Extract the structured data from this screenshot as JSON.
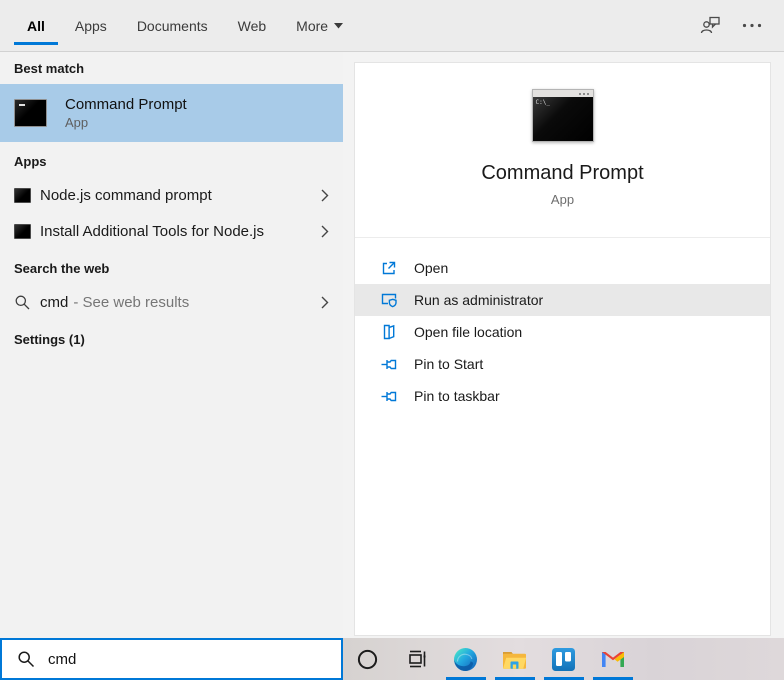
{
  "colors": {
    "accent": "#0078d7",
    "best_match_highlight": "#a8cbe8",
    "selected_action_bg": "#e8e8e8",
    "topbar_bg": "#ececec",
    "panel_bg": "#f2f2f2"
  },
  "topbar": {
    "tabs": [
      {
        "label": "All",
        "active": true
      },
      {
        "label": "Apps",
        "active": false
      },
      {
        "label": "Documents",
        "active": false
      },
      {
        "label": "Web",
        "active": false
      },
      {
        "label": "More",
        "active": false,
        "has_dropdown": true
      }
    ],
    "icons": [
      "feedback-icon",
      "ellipsis-icon"
    ]
  },
  "left_panel": {
    "best_match_header": "Best match",
    "best_match": {
      "title": "Command Prompt",
      "subtitle": "App",
      "selected": true
    },
    "apps_header": "Apps",
    "apps": [
      {
        "title": "Node.js command prompt"
      },
      {
        "title": "Install Additional Tools for Node.js"
      }
    ],
    "web_header": "Search the web",
    "web_result": {
      "title": "cmd",
      "suffix": "- See web results"
    },
    "settings_header": "Settings (1)"
  },
  "preview": {
    "title": "Command Prompt",
    "subtitle": "App",
    "cmd_icon_text": "C:\\_",
    "actions": [
      {
        "label": "Open",
        "icon": "open-icon",
        "highlighted": false
      },
      {
        "label": "Run as administrator",
        "icon": "shield-icon",
        "highlighted": true
      },
      {
        "label": "Open file location",
        "icon": "folder-icon",
        "highlighted": false
      },
      {
        "label": "Pin to Start",
        "icon": "pin-icon",
        "highlighted": false
      },
      {
        "label": "Pin to taskbar",
        "icon": "pin-icon",
        "highlighted": false
      }
    ]
  },
  "search_box": {
    "value": "cmd"
  },
  "taskbar": {
    "icons": [
      "cortana",
      "task-view",
      "edge",
      "file-explorer",
      "trello",
      "gmail"
    ],
    "running": [
      "edge",
      "file-explorer",
      "trello",
      "gmail"
    ]
  }
}
